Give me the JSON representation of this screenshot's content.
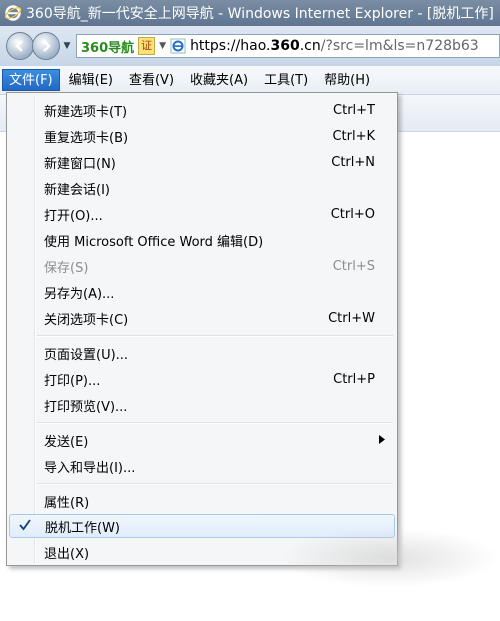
{
  "window": {
    "title": "360导航_新一代安全上网导航 - Windows Internet Explorer - [脱机工作]"
  },
  "address": {
    "brand": "360导航",
    "cert": "证",
    "url_host": "https://hao.",
    "url_bold": "360",
    "url_rest": ".cn",
    "url_path": "/?src=lm&ls=n728b63"
  },
  "menubar": [
    {
      "label": "文件(F)"
    },
    {
      "label": "编辑(E)"
    },
    {
      "label": "查看(V)"
    },
    {
      "label": "收藏夹(A)"
    },
    {
      "label": "工具(T)"
    },
    {
      "label": "帮助(H)"
    }
  ],
  "file_menu": [
    {
      "label": "新建选项卡(T)",
      "shortcut": "Ctrl+T"
    },
    {
      "label": "重复选项卡(B)",
      "shortcut": "Ctrl+K"
    },
    {
      "label": "新建窗口(N)",
      "shortcut": "Ctrl+N"
    },
    {
      "label": "新建会话(I)",
      "shortcut": ""
    },
    {
      "label": "打开(O)...",
      "shortcut": "Ctrl+O"
    },
    {
      "label": "使用 Microsoft Office Word 编辑(D)",
      "shortcut": ""
    },
    {
      "label": "保存(S)",
      "shortcut": "Ctrl+S",
      "disabled": true
    },
    {
      "label": "另存为(A)...",
      "shortcut": ""
    },
    {
      "label": "关闭选项卡(C)",
      "shortcut": "Ctrl+W"
    },
    {
      "label": "页面设置(U)...",
      "shortcut": ""
    },
    {
      "label": "打印(P)...",
      "shortcut": "Ctrl+P"
    },
    {
      "label": "打印预览(V)...",
      "shortcut": ""
    },
    {
      "label": "发送(E)",
      "shortcut": "",
      "submenu": true
    },
    {
      "label": "导入和导出(I)...",
      "shortcut": ""
    },
    {
      "label": "属性(R)",
      "shortcut": ""
    },
    {
      "label": "脱机工作(W)",
      "shortcut": "",
      "checked": true,
      "highlighted": true
    },
    {
      "label": "退出(X)",
      "shortcut": ""
    }
  ],
  "colors": {
    "menu_active": "#2168c4",
    "brand_green": "#2a8b1f"
  }
}
